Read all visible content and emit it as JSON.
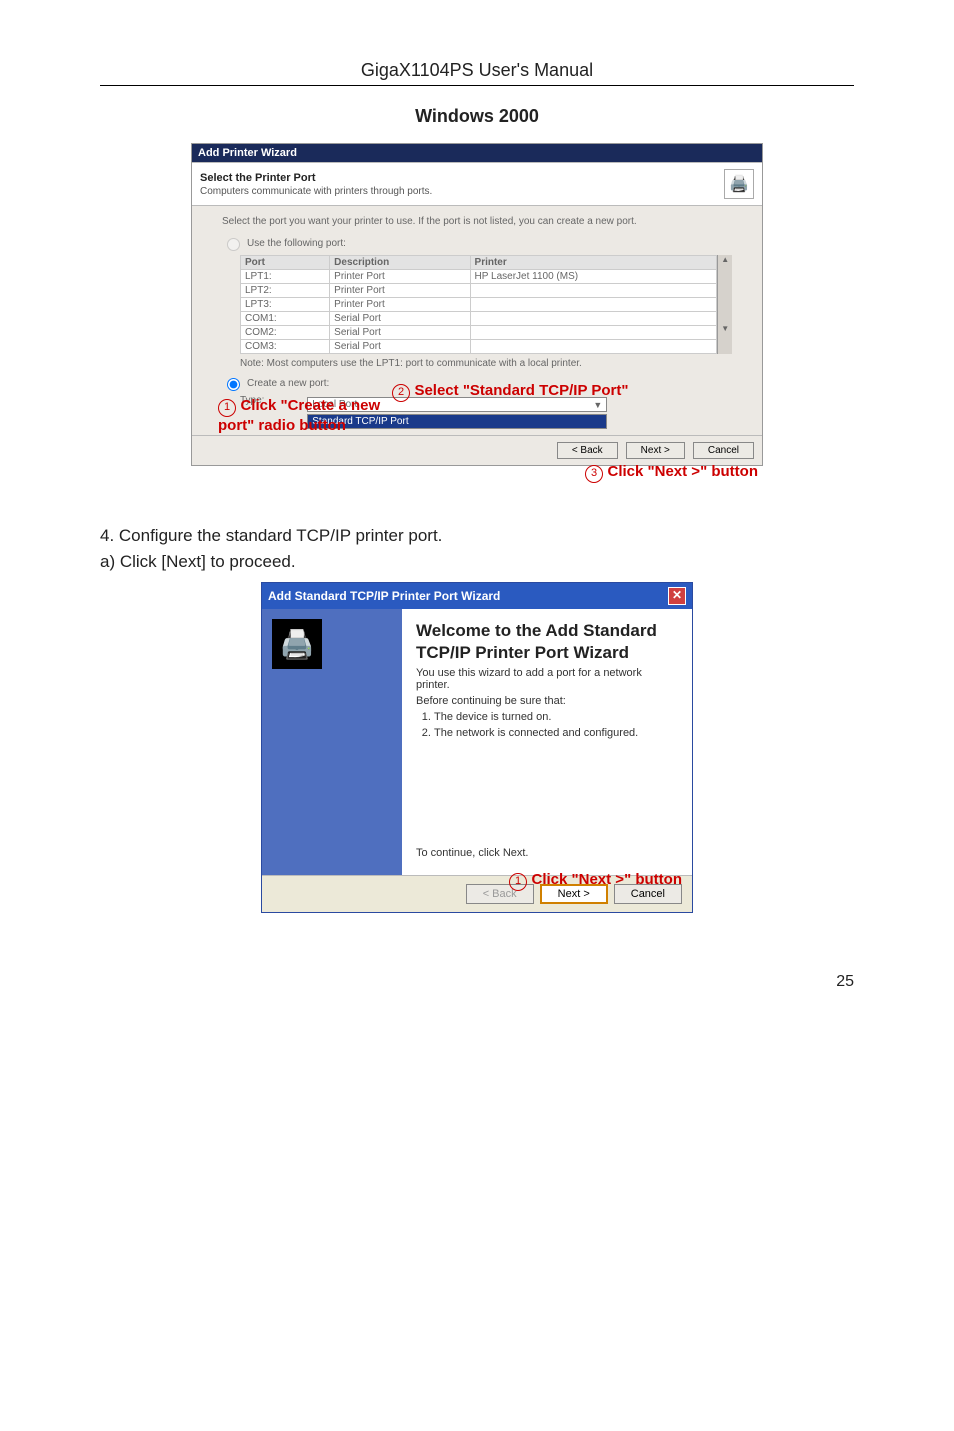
{
  "header": "GigaX1104PS User's Manual",
  "section_title": "Windows 2000",
  "step4": "4. Configure the standard TCP/IP printer port.",
  "step4a": "a) Click [Next] to proceed.",
  "page_number": "25",
  "shot1": {
    "titlebar": "Add Printer Wizard",
    "wiz_title": "Select the Printer Port",
    "wiz_sub": "Computers communicate with printers through ports.",
    "instr": "Select the port you want your printer to use.  If the port is not listed, you can create a new port.",
    "use_following": "Use the following port:",
    "col_port": "Port",
    "col_desc": "Description",
    "col_printer": "Printer",
    "rows": [
      {
        "p": "LPT1:",
        "d": "Printer Port",
        "pr": "HP LaserJet 1100 (MS)"
      },
      {
        "p": "LPT2:",
        "d": "Printer Port",
        "pr": ""
      },
      {
        "p": "LPT3:",
        "d": "Printer Port",
        "pr": ""
      },
      {
        "p": "COM1:",
        "d": "Serial Port",
        "pr": ""
      },
      {
        "p": "COM2:",
        "d": "Serial Port",
        "pr": ""
      },
      {
        "p": "COM3:",
        "d": "Serial Port",
        "pr": ""
      }
    ],
    "note": "Note: Most computers use the LPT1: port to communicate with a local printer.",
    "create_new": "Create a new port:",
    "type_label": "Type:",
    "drop_option1": "Local Port",
    "drop_selected": "Standard TCP/IP Port",
    "back_btn": "< Back",
    "next_btn": "Next >",
    "cancel_btn": "Cancel",
    "anno1": "Click \"Create a new port\" radio button",
    "anno2": "Select \"Standard TCP/IP Port\"",
    "anno3": "Click \"Next >\" button"
  },
  "shot2": {
    "titlebar": "Add Standard TCP/IP Printer Port Wizard",
    "h1_line1": "Welcome to the Add Standard",
    "h1_line2": "TCP/IP Printer Port Wizard",
    "intro": "You use this wizard to add a port for a network printer.",
    "before": "Before continuing be sure that:",
    "li1": "The device is turned on.",
    "li2": "The network is connected and configured.",
    "cont": "To continue, click Next.",
    "back_btn": "< Back",
    "next_btn": "Next >",
    "cancel_btn": "Cancel",
    "anno1": "Click \"Next >\" button"
  }
}
